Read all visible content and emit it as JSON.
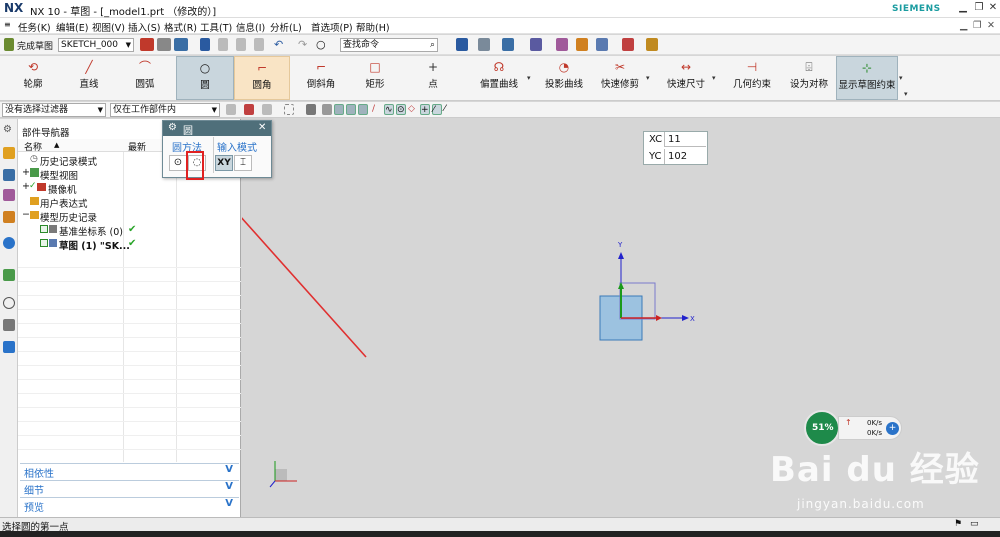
{
  "window": {
    "app_logo": "NX",
    "title": "NX 10 - 草图 - [_model1.prt （修改的）]",
    "brand": "SIEMENS",
    "minimize": "▁",
    "restore": "❐",
    "close": "✕",
    "doc_minimize": "▁",
    "doc_restore": "❐",
    "doc_close": "✕"
  },
  "menubar": {
    "items": [
      "任务(K)",
      "编辑(E)",
      "视图(V)",
      "插入(S)",
      "格式(R)",
      "工具(T)",
      "信息(I)",
      "分析(L)",
      "首选项(P)",
      "帮助(H)"
    ]
  },
  "toolbar1": {
    "finish_sketch": "完成草图",
    "sketch_name": "SKETCH_000",
    "search_placeholder": "查找命令",
    "search_icon": "⌕"
  },
  "ribbon": {
    "buttons": [
      {
        "label": "轮廓",
        "icon": "⟲"
      },
      {
        "label": "直线",
        "icon": "╱"
      },
      {
        "label": "圆弧",
        "icon": "⌒"
      },
      {
        "label": "圆",
        "icon": "○"
      },
      {
        "label": "圆角",
        "icon": "⌐"
      },
      {
        "label": "倒斜角",
        "icon": "⌐"
      },
      {
        "label": "矩形",
        "icon": "□"
      },
      {
        "label": "点",
        "icon": "+"
      },
      {
        "label": "偏置曲线",
        "icon": "☊"
      },
      {
        "label": "投影曲线",
        "icon": "◔"
      },
      {
        "label": "快速修剪",
        "icon": "✂"
      },
      {
        "label": "快速尺寸",
        "icon": "↔"
      },
      {
        "label": "几何约束",
        "icon": "⊣"
      },
      {
        "label": "设为对称",
        "icon": "⌹"
      },
      {
        "label": "显示草图约束",
        "icon": "⊹"
      }
    ]
  },
  "toolbar2": {
    "filter": "没有选择过滤器",
    "scope": "仅在工作部件内"
  },
  "navigator": {
    "title": "部件导航器",
    "col_name": "名称",
    "col_sort": "▲",
    "col_latest": "最新",
    "rows": [
      {
        "text": "历史记录模式",
        "expander": "",
        "check": ""
      },
      {
        "text": "模型视图",
        "expander": "+",
        "check": ""
      },
      {
        "text": "摄像机",
        "expander": "+",
        "check": "✓"
      },
      {
        "text": "用户表达式",
        "expander": "",
        "check": ""
      },
      {
        "text": "模型历史记录",
        "expander": "−",
        "check": ""
      },
      {
        "text": "基准坐标系 (0)",
        "expander": "",
        "check": "✔"
      },
      {
        "text": "草图 (1) \"SK...",
        "expander": "",
        "check": "✔"
      }
    ],
    "panels": [
      "相依性",
      "细节",
      "预览"
    ],
    "panel_chevron": "V"
  },
  "dialog": {
    "title": "圆",
    "gear": "⚙",
    "close": "✕",
    "method_label": "圆方法",
    "input_label": "输入模式",
    "method_center": "⊙",
    "method_3pt": "◌",
    "input_xy": "XY",
    "input_param": "⌶"
  },
  "coords": {
    "xc_label": "XC",
    "xc_value": "11",
    "yc_label": "YC",
    "yc_value": "102"
  },
  "viewport": {
    "axis_x": "X",
    "axis_y": "Y"
  },
  "speed_widget": {
    "percent": "51%",
    "up": "0K/s",
    "down": "0K/s"
  },
  "watermark": {
    "line1": "Bai du 经验",
    "line2": "jingyan.baidu.com"
  },
  "status": {
    "message": "选择圆的第一点"
  },
  "colors": {
    "accent": "#2a73c9",
    "brand": "#1a9ca0",
    "title_panel": "#4f6f7a",
    "highlight": "#e02020"
  }
}
